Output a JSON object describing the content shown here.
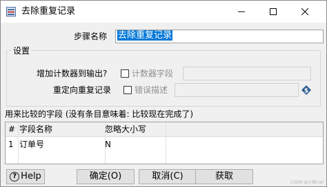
{
  "window": {
    "title": "去除重复记录"
  },
  "step": {
    "label": "步骤名称",
    "value": "去除重复记录"
  },
  "settings": {
    "group_title": "设置",
    "add_counter_label": "增加计数器到输出?",
    "counter_field_label": "计数器字段",
    "redirect_label": "重定向重复记录",
    "error_desc_label": "错误描述"
  },
  "table": {
    "caption": "用来比较的字段 (没有条目意味着: 比较现在完成了)",
    "headers": [
      "#",
      "字段名称",
      "忽略大小写"
    ],
    "rows": [
      [
        "1",
        "订单号",
        "N"
      ]
    ]
  },
  "buttons": {
    "help": "Help",
    "ok": "确定(O)",
    "cancel": "取消(C)",
    "get": "获取"
  },
  "watermark": "CSDN @小菜t'ail"
}
